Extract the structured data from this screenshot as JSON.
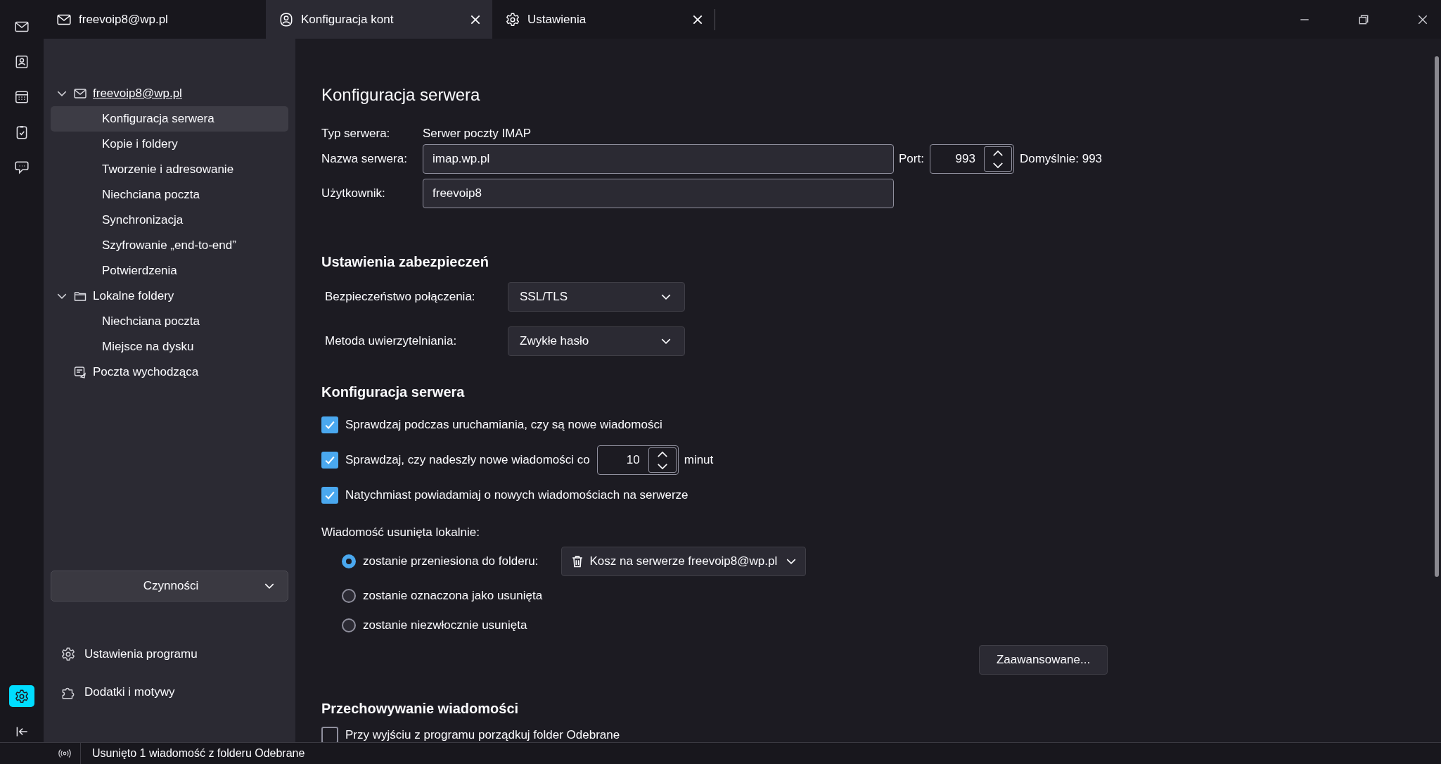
{
  "spaces_bar": {
    "items": [
      {
        "kind": "mail",
        "selected": false
      },
      {
        "kind": "contacts",
        "selected": false
      },
      {
        "kind": "calendar",
        "selected": false
      },
      {
        "kind": "tasks",
        "selected": false
      },
      {
        "kind": "chat",
        "selected": false
      }
    ],
    "settings": {
      "selected": true
    }
  },
  "tabs": [
    {
      "kind": "mail",
      "label": "freevoip8@wp.pl",
      "selected": false,
      "closable": false
    },
    {
      "kind": "account",
      "label": "Konfiguracja kont",
      "selected": true,
      "closable": true
    },
    {
      "kind": "settings",
      "label": "Ustawienia",
      "selected": false,
      "closable": true
    }
  ],
  "sidebar": {
    "tree": [
      {
        "kind": "account",
        "label": "freevoip8@wp.pl",
        "expanded": true,
        "children": [
          {
            "label": "Konfiguracja serwera",
            "selected": true
          },
          {
            "label": "Kopie i foldery",
            "selected": false
          },
          {
            "label": "Tworzenie i adresowanie",
            "selected": false
          },
          {
            "label": "Niechciana poczta",
            "selected": false
          },
          {
            "label": "Synchronizacja",
            "selected": false
          },
          {
            "label": "Szyfrowanie „end-to-end”",
            "selected": false
          },
          {
            "label": "Potwierdzenia",
            "selected": false
          }
        ]
      },
      {
        "kind": "folder",
        "label": "Lokalne foldery",
        "expanded": true,
        "children": [
          {
            "label": "Niechciana poczta",
            "selected": false
          },
          {
            "label": "Miejsce na dysku",
            "selected": false
          }
        ]
      },
      {
        "kind": "outbox",
        "label": "Poczta wychodząca"
      }
    ],
    "actions_button": "Czynności",
    "links": [
      {
        "kind": "settings",
        "label": "Ustawienia programu"
      },
      {
        "kind": "addons",
        "label": "Dodatki i motywy"
      }
    ]
  },
  "main": {
    "title": "Konfiguracja serwera",
    "server_type_label": "Typ serwera:",
    "server_type": "Serwer poczty IMAP",
    "server_name_label": "Nazwa serwera:",
    "server_name": "imap.wp.pl",
    "port_label": "Port:",
    "port": "993",
    "port_default": "Domyślnie: 993",
    "user_label": "Użytkownik:",
    "user": "freevoip8",
    "security_heading": "Ustawienia zabezpieczeń",
    "connection_security_label": "Bezpieczeństwo połączenia:",
    "connection_security": "SSL/TLS",
    "auth_method_label": "Metoda uwierzytelniania:",
    "auth_method": "Zwykłe hasło",
    "server_settings_heading": "Konfiguracja serwera",
    "checks": [
      {
        "label": "Sprawdzaj podczas uruchamiania, czy są nowe wiadomości",
        "checked": true
      },
      {
        "label": "Sprawdzaj, czy nadeszły nowe wiadomości co",
        "checked": true,
        "minutes": "10",
        "unit": "minut"
      },
      {
        "label": "Natychmiast powiadamiaj o nowych wiadomościach na serwerze",
        "checked": true
      }
    ],
    "deleted_label": "Wiadomość usunięta lokalnie:",
    "delete_options": [
      {
        "label": "zostanie przeniesiona do folderu:",
        "selected": true,
        "folder": "Kosz na serwerze freevoip8@wp.pl"
      },
      {
        "label": "zostanie oznaczona jako usunięta",
        "selected": false
      },
      {
        "label": "zostanie niezwłocznie usunięta",
        "selected": false
      }
    ],
    "advanced_button": "Zaawansowane...",
    "storage_heading": "Przechowywanie wiadomości",
    "storage_checks": [
      {
        "label": "Przy wyjściu z programu porządkuj folder Odebrane",
        "checked": false
      }
    ]
  },
  "status_bar": {
    "text": "Usunięto 1 wiadomość z folderu Odebrane"
  }
}
